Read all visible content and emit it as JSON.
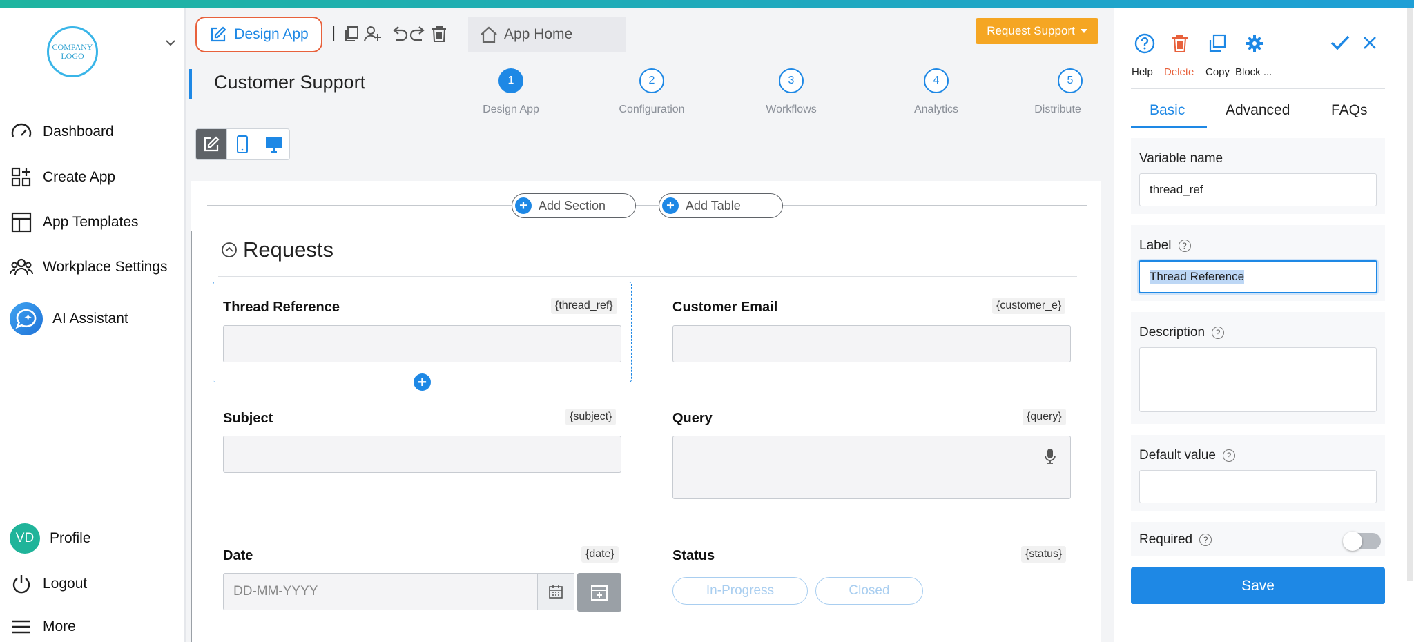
{
  "colors": {
    "accent": "#1e88e5",
    "warning": "#f5a623",
    "danger": "#e8613c",
    "profile": "#20b49a"
  },
  "sidebar": {
    "logo_text": "COMPANY LOGO",
    "items": [
      {
        "label": "Dashboard",
        "icon": "gauge-icon"
      },
      {
        "label": "Create App",
        "icon": "add-apps-icon"
      },
      {
        "label": "App Templates",
        "icon": "template-icon"
      },
      {
        "label": "Workplace Settings",
        "icon": "users-icon"
      },
      {
        "label": "AI Assistant",
        "icon": "ai-chat-icon"
      }
    ],
    "profile": {
      "initials": "VD",
      "label": "Profile"
    },
    "logout": "Logout",
    "more": "More"
  },
  "toolbar": {
    "design_app": "Design App",
    "separator": "|",
    "app_home": "App Home",
    "request_support": "Request Support"
  },
  "page_title": "Customer Support",
  "stepper": [
    {
      "num": "1",
      "label": "Design App",
      "active": true
    },
    {
      "num": "2",
      "label": "Configuration",
      "active": false
    },
    {
      "num": "3",
      "label": "Workflows",
      "active": false
    },
    {
      "num": "4",
      "label": "Analytics",
      "active": false
    },
    {
      "num": "5",
      "label": "Distribute",
      "active": false
    }
  ],
  "canvas": {
    "add_section": "Add Section",
    "add_table": "Add Table",
    "section_title": "Requests",
    "fields": {
      "thread_ref": {
        "label": "Thread Reference",
        "tag": "{thread_ref}"
      },
      "customer_email": {
        "label": "Customer Email",
        "tag": "{customer_e}"
      },
      "subject": {
        "label": "Subject",
        "tag": "{subject}"
      },
      "query": {
        "label": "Query",
        "tag": "{query}"
      },
      "date": {
        "label": "Date",
        "tag": "{date}",
        "placeholder": "DD-MM-YYYY"
      },
      "status": {
        "label": "Status",
        "tag": "{status}",
        "options": [
          "In-Progress",
          "Closed"
        ]
      }
    }
  },
  "panel": {
    "actions": {
      "help": "Help",
      "delete": "Delete",
      "copy": "Copy",
      "block": "Block ..."
    },
    "tabs": [
      "Basic",
      "Advanced",
      "FAQs"
    ],
    "variable_name": {
      "label": "Variable name",
      "value": "thread_ref"
    },
    "label": {
      "label": "Label",
      "value": "Thread Reference"
    },
    "description": {
      "label": "Description",
      "value": ""
    },
    "default_value": {
      "label": "Default value",
      "value": ""
    },
    "required": {
      "label": "Required",
      "on": false
    },
    "help_mark": "?",
    "save": "Save"
  }
}
